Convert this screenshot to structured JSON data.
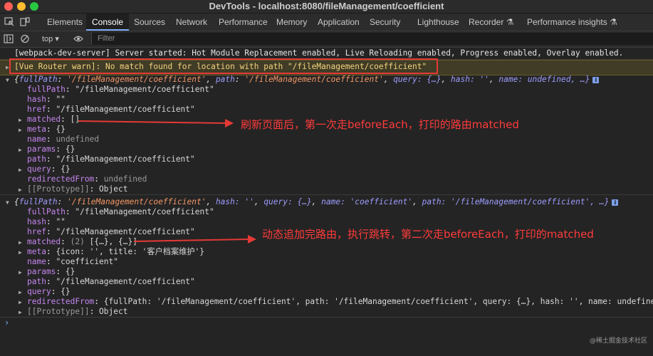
{
  "window": {
    "title": "DevTools - localhost:8080/fileManagement/coefficient"
  },
  "tabs": [
    "Elements",
    "Console",
    "Sources",
    "Network",
    "Performance",
    "Memory",
    "Application",
    "Security",
    "Lighthouse",
    "Recorder ⚗",
    "Performance insights ⚗"
  ],
  "toolbar": {
    "context": "top ▾",
    "filter_placeholder": "Filter"
  },
  "messages": {
    "server": "[webpack-dev-server] Server started: Hot Module Replacement enabled, Live Reloading enabled, Progress enabled, Overlay enabled.",
    "warn": "[Vue Router warn]: No match found for location with path \"/fileManagement/coefficient\""
  },
  "obj1": {
    "summary_fp_key": "fullPath",
    "summary_fp_val": "'/fileManagement/coefficient'",
    "summary_path_key": "path",
    "summary_path_val": "'/fileManagement/coefficient'",
    "summary_query": "query: {…}",
    "summary_hash": "hash: ''",
    "summary_name": "name: undefined, …}",
    "fullPath": "\"/fileManagement/coefficient\"",
    "hash": "\"\"",
    "href": "\"/fileManagement/coefficient\"",
    "matched": "[]",
    "meta": "{}",
    "name": "undefined",
    "params": "{}",
    "path": "\"/fileManagement/coefficient\"",
    "query": "{}",
    "redirectedFrom": "undefined",
    "prototype": "Object"
  },
  "obj2": {
    "summary_fp_val": "'/fileManagement/coefficient'",
    "summary_hash": "hash: ''",
    "summary_query": "query: {…}",
    "summary_name": "name: 'coefficient'",
    "summary_path": "path: '/fileManagement/coefficient', …}",
    "fullPath": "\"/fileManagement/coefficient\"",
    "hash": "\"\"",
    "href": "\"/fileManagement/coefficient\"",
    "matched_count": "(2)",
    "matched": "[{…}, {…}]",
    "meta": "{icon: '', title: '客户档案维护'}",
    "name": "\"coefficient\"",
    "params": "{}",
    "path": "\"/fileManagement/coefficient\"",
    "query": "{}",
    "redirectedFrom": "{fullPath: '/fileManagement/coefficient', path: '/fileManagement/coefficient', query: {…}, hash: '', name: undefined, …}",
    "prototype": "Object"
  },
  "annotations": {
    "first": "刷新页面后，第一次走beforeEach，打印的路由matched",
    "second": "动态追加完路由，执行跳转，第二次走beforeEach，打印的matched"
  },
  "watermark": "@稀土掘金技术社区",
  "colors": {
    "annotation": "#ff3b3b",
    "active_tab": "#7cacf8",
    "warn_bg": "#413c26"
  }
}
